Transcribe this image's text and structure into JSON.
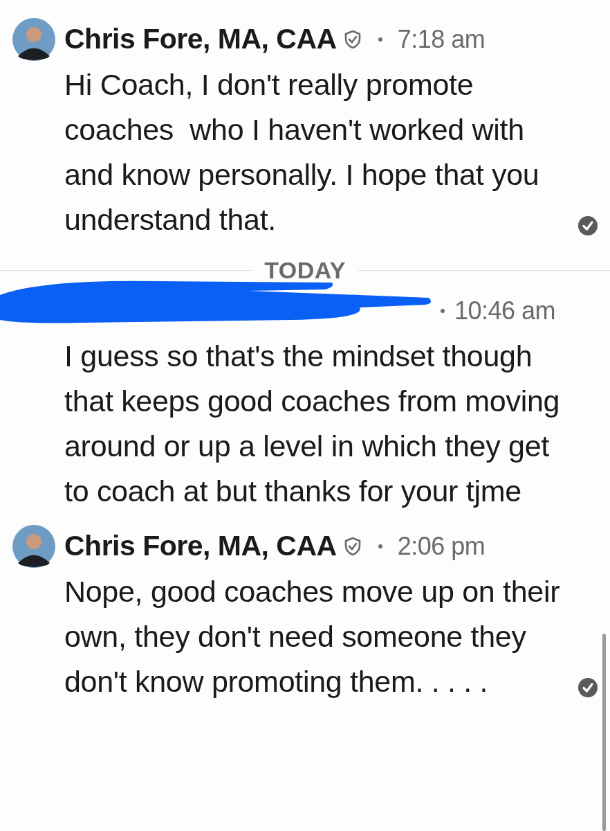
{
  "items": [
    {
      "kind": "message",
      "sender": "Chris Fore, MA, CAA",
      "avatar": true,
      "verified": true,
      "redacted": false,
      "time": "7:18 am",
      "text": "Hi Coach, I don't really promote coaches  who I haven't worked with and know personally. I hope that you understand that.",
      "read": true
    },
    {
      "kind": "separator",
      "label": "TODAY"
    },
    {
      "kind": "message",
      "avatar": false,
      "verified": false,
      "redacted": true,
      "time": "10:46 am",
      "text": "I guess so that's the mindset though that keeps good coaches from moving around or up a level in which they get to coach at but thanks for your tjme",
      "read": false
    },
    {
      "kind": "message",
      "sender": "Chris Fore, MA, CAA",
      "avatar": true,
      "verified": true,
      "redacted": false,
      "time": "2:06 pm",
      "text": "Nope, good coaches move up on their own, they don't need someone they don't know promoting them. . . . .",
      "read": true
    }
  ]
}
